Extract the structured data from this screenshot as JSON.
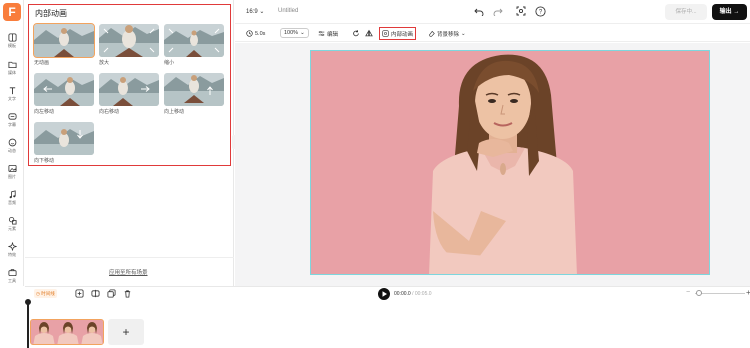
{
  "app": {
    "logo_letter": "F"
  },
  "sidebar": {
    "items": [
      {
        "label": "模板",
        "icon": "template-icon"
      },
      {
        "label": "媒体",
        "icon": "folder-icon"
      },
      {
        "label": "文字",
        "icon": "text-icon"
      },
      {
        "label": "字幕",
        "icon": "subtitle-icon"
      },
      {
        "label": "动态",
        "icon": "sticker-icon"
      },
      {
        "label": "图片",
        "icon": "image-icon"
      },
      {
        "label": "音频",
        "icon": "music-icon"
      },
      {
        "label": "元素",
        "icon": "elements-icon"
      },
      {
        "label": "特效",
        "icon": "effects-icon"
      },
      {
        "label": "工具",
        "icon": "toolbox-icon"
      }
    ]
  },
  "panel": {
    "title": "内部动画",
    "animations": [
      {
        "label": "无动画",
        "selected": true
      },
      {
        "label": "放大",
        "selected": false
      },
      {
        "label": "缩小",
        "selected": false
      },
      {
        "label": "向左移动",
        "selected": false
      },
      {
        "label": "向右移动",
        "selected": false
      },
      {
        "label": "向上移动",
        "selected": false
      },
      {
        "label": "向下移动",
        "selected": false
      }
    ],
    "apply_all": "应用至所有场景"
  },
  "topbar": {
    "ratio": "16:9",
    "doc_title": "Untitled",
    "save_label": "保存中...",
    "export_label": "输出"
  },
  "toolbar": {
    "duration": "5.0s",
    "zoom": "100%",
    "edit": "编辑",
    "inner_animation": "内部动画",
    "bg_remove": "背景移除"
  },
  "timeline": {
    "tag": "时间线",
    "current_time": "00:00.0",
    "total_time": "/ 00:05.0",
    "add_label": "+"
  },
  "colors": {
    "accent": "#f97d3c",
    "highlight": "#e03a3a",
    "photo_bg": "#e8a1a6",
    "selection": "#7dd6dd"
  }
}
